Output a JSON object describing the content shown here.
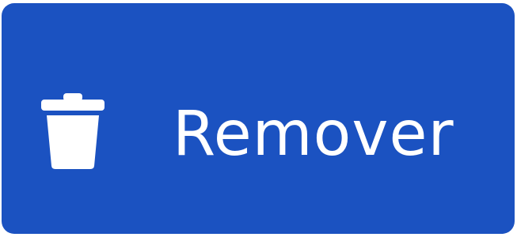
{
  "button": {
    "label": "Remover",
    "icon": "trash-icon",
    "background_color": "#1b52c1",
    "text_color": "#ffffff"
  }
}
